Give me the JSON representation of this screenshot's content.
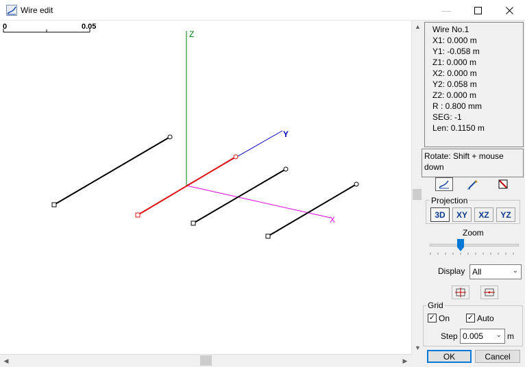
{
  "window": {
    "title": "Wire edit",
    "icons": {
      "app": "wire-edit-icon",
      "minimize": "minimize-icon",
      "maximize": "maximize-icon",
      "close": "close-icon"
    }
  },
  "canvas": {
    "scale_label_start": "0",
    "scale_label_end": "0.05",
    "axes": {
      "z": "Z",
      "y": "Y",
      "x": "X"
    },
    "colors": {
      "z": "#008000",
      "y": "#0000c0",
      "x": "#e000e0",
      "selected_wire": "#e01010",
      "wire": "#000000"
    }
  },
  "wire_info": {
    "lines": [
      "Wire No.1",
      "X1: 0.000 m",
      "Y1: -0.058 m",
      "Z1: 0.000 m",
      "X2: 0.000 m",
      "Y2: 0.058 m",
      "Z2: 0.000 m",
      "R : 0.800 mm",
      "SEG: -1",
      "Len: 0.1150 m"
    ]
  },
  "hint": "Rotate: Shift + mouse down",
  "tools": [
    "edit-wire-icon",
    "draw-wire-icon",
    "delete-wire-icon"
  ],
  "projection": {
    "label": "Projection",
    "buttons": [
      "3D",
      "XY",
      "XZ",
      "YZ"
    ],
    "selected": "3D"
  },
  "zoom": {
    "label": "Zoom",
    "level": 0.33
  },
  "display": {
    "label": "Display",
    "value": "All"
  },
  "view_icons": [
    "fit-view-icon",
    "center-view-icon"
  ],
  "grid": {
    "label": "Grid",
    "on_label": "On",
    "on_checked": true,
    "auto_label": "Auto",
    "auto_checked": true,
    "step_label": "Step",
    "step_value": "0.005",
    "step_unit": "m"
  },
  "buttons": {
    "ok": "OK",
    "cancel": "Cancel"
  }
}
